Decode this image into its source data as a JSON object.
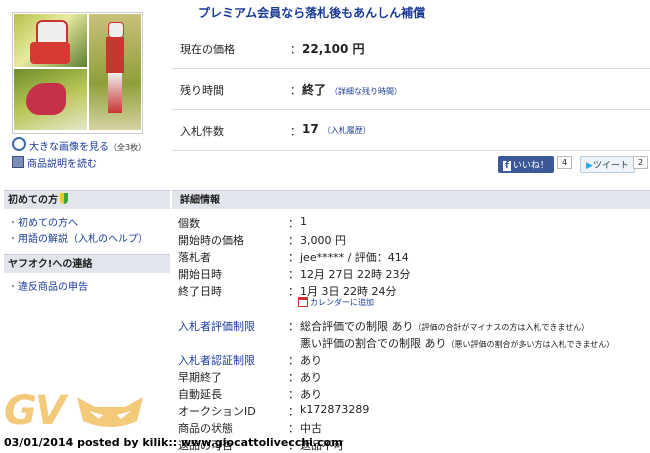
{
  "promo": "プレミアム会員なら落札後もあんしん補償",
  "image_links": {
    "large": "大きな画像を見る",
    "large_count": "（全3枚）",
    "desc": "商品説明を読む"
  },
  "info": {
    "price_label": "現在の価格",
    "price_value": "22,100 円",
    "time_label": "残り時間",
    "time_value": "終了",
    "time_link": "（詳細な残り時間）",
    "bids_label": "入札件数",
    "bids_value": "17",
    "bids_link": "（入札履歴）"
  },
  "social": {
    "like": "いいね！",
    "like_count": "4",
    "tweet": "ツイート",
    "tweet_count": "2"
  },
  "sidebar": {
    "first_head": "初めての方",
    "first_items": [
      "初めての方へ",
      "用語の解説（入札のヘルプ）"
    ],
    "contact_head": "ヤフオク!への連絡",
    "contact_items": [
      "違反商品の申告"
    ]
  },
  "details": {
    "head": "詳細情報",
    "rows": [
      {
        "label": "個数",
        "value": "1"
      },
      {
        "label": "開始時の価格",
        "value": "3,000 円"
      },
      {
        "label": "落札者",
        "value": "jee***** / 評価：414"
      },
      {
        "label": "開始日時",
        "value": "12月 27日 22時 23分"
      },
      {
        "label": "終了日時",
        "value": "1月 3日 22時 24分"
      }
    ],
    "calendar": "カレンダーに追加",
    "eval_label": "入札者評価制限",
    "eval_1": "総合評価での制限 あり",
    "eval_1_note": "（評価の合計がマイナスの方は入札できません）",
    "eval_2": "悪い評価の割合での制限 あり",
    "eval_2_note": "（悪い評価の割合が多い方は入札できません）",
    "rows2": [
      {
        "label": "入札者認証制限",
        "value": "あり",
        "link": true
      },
      {
        "label": "早期終了",
        "value": "あり"
      },
      {
        "label": "自動延長",
        "value": "あり"
      },
      {
        "label": "オークションID",
        "value": "k172873289"
      },
      {
        "label": "商品の状態",
        "value": "中古"
      },
      {
        "label": "返品の可否",
        "value": "返品不可"
      }
    ]
  },
  "watermark": {
    "logo": "GV",
    "footer": "03/01/2014 posted by kilik:: www.giocattolivecchi.com"
  },
  "colors": {
    "link": "#1a3a9a",
    "header_bg": "#e2e5ec",
    "watermark": "#f3c97a"
  }
}
